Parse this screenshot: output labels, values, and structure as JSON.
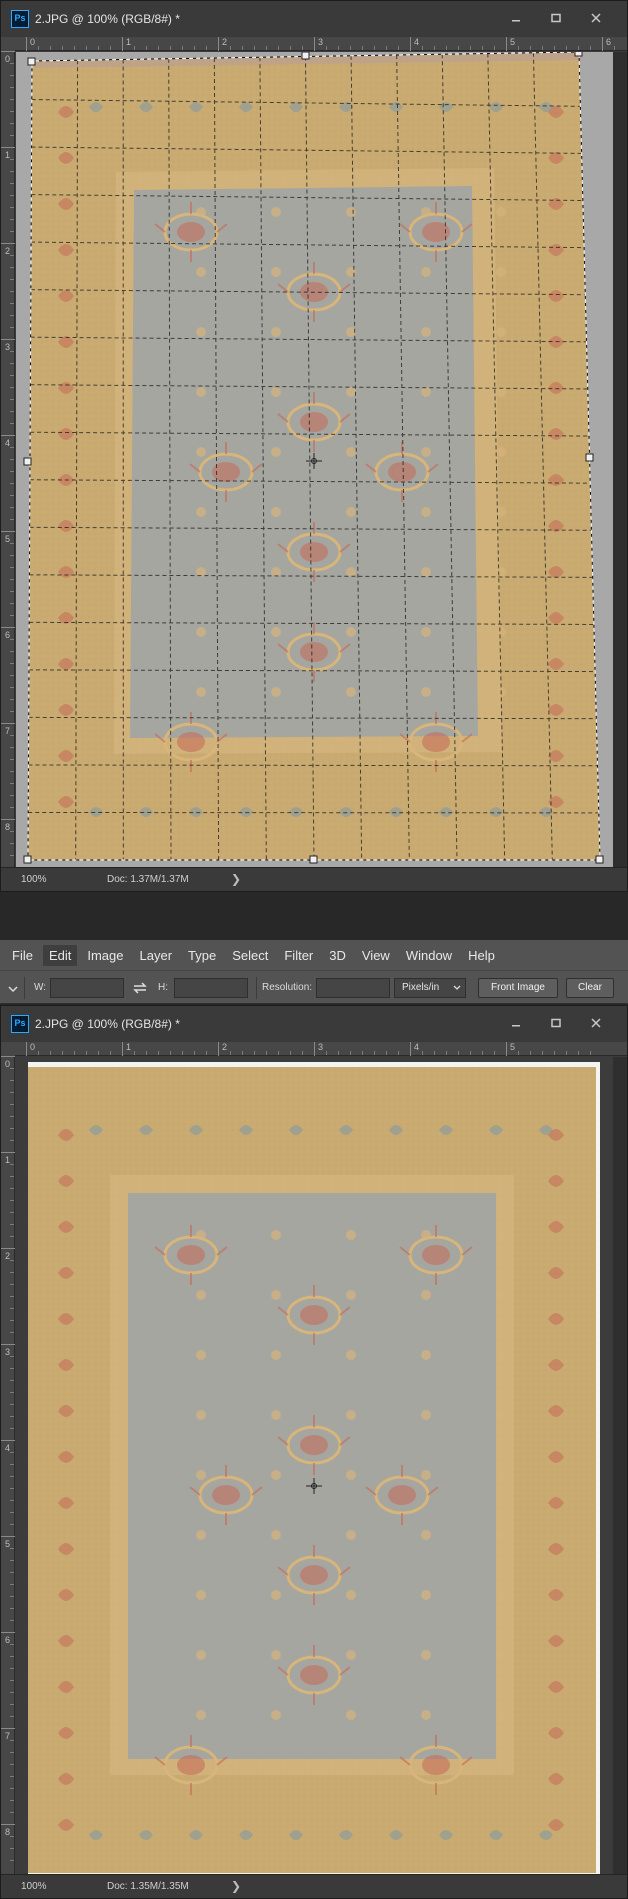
{
  "window1": {
    "title": "2.JPG @ 100% (RGB/8#) *",
    "status_zoom": "100%",
    "status_doc": "Doc: 1.37M/1.37M",
    "ruler_h_labels": [
      "0",
      "1",
      "2",
      "3",
      "4",
      "5",
      "6"
    ],
    "ruler_v_labels": [
      "0",
      "1",
      "2",
      "3",
      "4",
      "5",
      "6",
      "7",
      "8"
    ]
  },
  "window2": {
    "title": "2.JPG @ 100% (RGB/8#) *",
    "status_zoom": "100%",
    "status_doc": "Doc: 1.35M/1.35M",
    "ruler_h_labels": [
      "0",
      "1",
      "2",
      "3",
      "4",
      "5"
    ],
    "ruler_v_labels": [
      "0",
      "1",
      "2",
      "3",
      "4",
      "5",
      "6",
      "7",
      "8"
    ]
  },
  "menubar": {
    "items": [
      "File",
      "Edit",
      "Image",
      "Layer",
      "Type",
      "Select",
      "Filter",
      "3D",
      "View",
      "Window",
      "Help"
    ]
  },
  "optionsbar": {
    "w_label": "W:",
    "h_label": "H:",
    "resolution_label": "Resolution:",
    "units_value": "Pixels/in",
    "front_image_label": "Front Image",
    "clear_label": "Clear"
  },
  "colors": {
    "rug_border": "#c9ab72",
    "rug_field": "#a5a6a0",
    "motif_red": "#c46a58",
    "motif_blue": "#7e97a8",
    "ps_blue": "#31a8ff"
  },
  "app_icon": "photoshop-icon"
}
